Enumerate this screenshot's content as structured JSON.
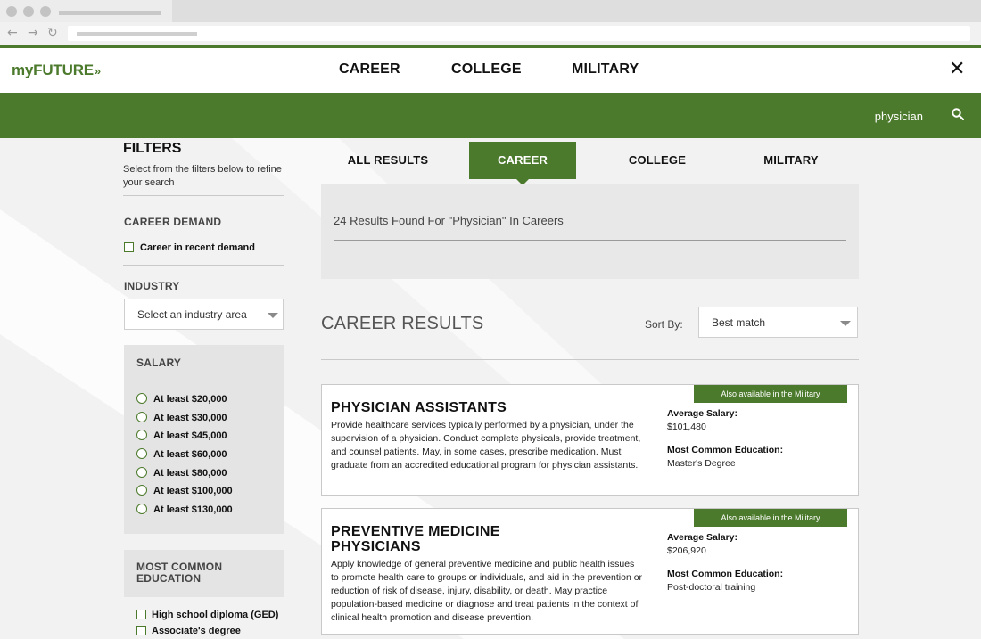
{
  "header": {
    "logo": "myFUTURE",
    "logo_arrows": "»",
    "nav": [
      "CAREER",
      "COLLEGE",
      "MILITARY"
    ],
    "close": "✕"
  },
  "search": {
    "term": "physician"
  },
  "filters": {
    "title": "FILTERS",
    "subtitle": "Select from the filters below to refine your search",
    "career_demand": {
      "title": "CAREER DEMAND",
      "option": "Career in recent demand"
    },
    "industry": {
      "title": "INDUSTRY",
      "placeholder": "Select an industry area"
    },
    "salary": {
      "title": "SALARY",
      "options": [
        "At least $20,000",
        "At least $30,000",
        "At least $45,000",
        "At least $60,000",
        "At least $80,000",
        "At least $100,000",
        "At least $130,000"
      ]
    },
    "education": {
      "title_line1": "MOST COMMON",
      "title_line2": "EDUCATION",
      "options": [
        "High school diploma (GED)",
        "Associate's degree"
      ]
    }
  },
  "tabs": {
    "all": "ALL RESULTS",
    "career": "CAREER",
    "college": "COLLEGE",
    "military": "MILITARY"
  },
  "results": {
    "count_text": "24 Results Found For \"Physician\" In Careers",
    "section_title": "CAREER RESULTS",
    "sort_label": "Sort By:",
    "sort_value": "Best match"
  },
  "cards": [
    {
      "badge": "Also available in the Military",
      "title": "PHYSICIAN ASSISTANTS",
      "description": "Provide healthcare services typically performed by a physician, under the supervision of a physician. Conduct complete physicals, provide treatment, and counsel patients. May, in some cases, prescribe medication. Must graduate from an accredited educational program for physician assistants.",
      "salary_label": "Average Salary:",
      "salary": "$101,480",
      "education_label": "Most Common Education:",
      "education": "Master's Degree"
    },
    {
      "badge": "Also available in the Military",
      "title_line1": "PREVENTIVE MEDICINE",
      "title_line2": "PHYSICIANS",
      "description": "Apply knowledge of general preventive medicine and public health issues to promote health care to groups or individuals, and aid in the prevention or reduction of risk of disease, injury, disability, or death. May practice population-based medicine or diagnose and treat patients in the context of clinical health promotion and disease prevention.",
      "salary_label": "Average Salary:",
      "salary": "$206,920",
      "education_label": "Most Common Education:",
      "education": "Post-doctoral training"
    }
  ],
  "colors": {
    "brand_green": "#4c7a2c",
    "panel_gray": "#e8e8e8"
  }
}
